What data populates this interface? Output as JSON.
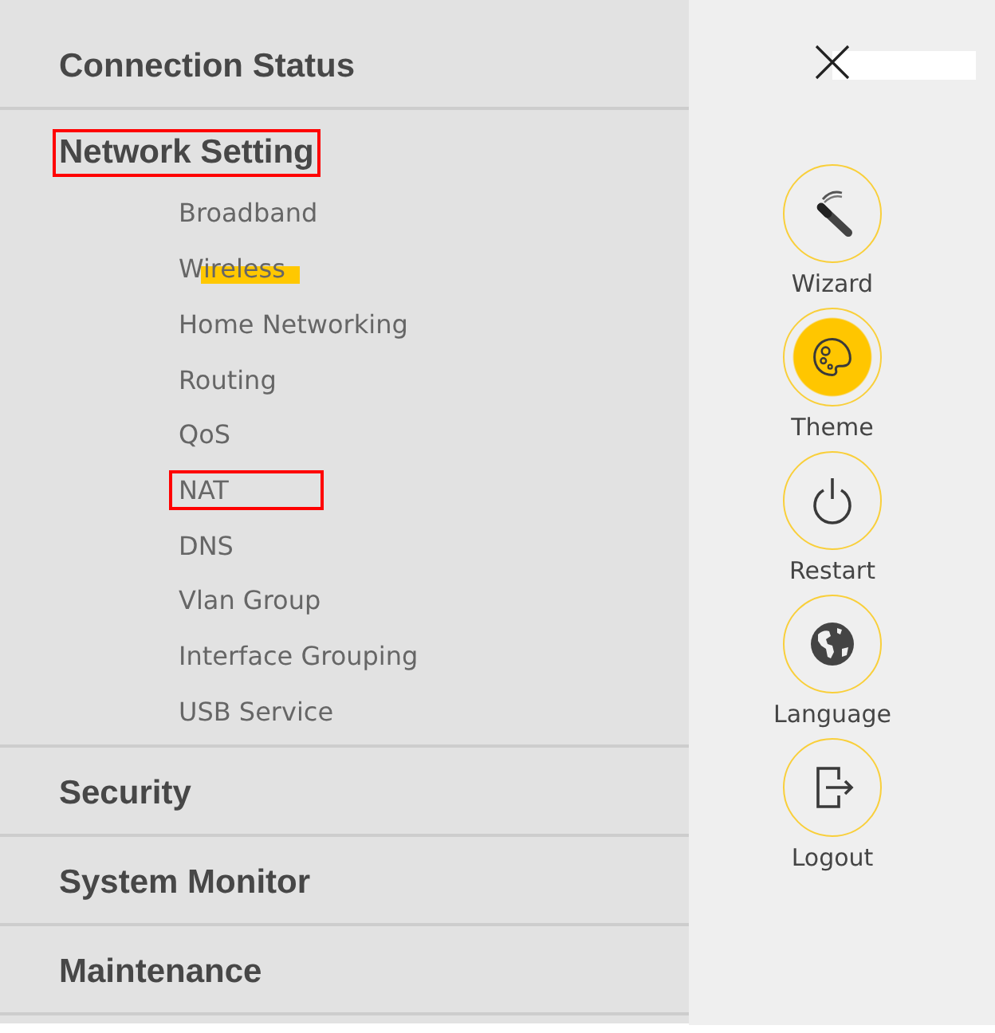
{
  "menu": [
    {
      "label": "Connection Status",
      "boxed": false
    },
    {
      "label": "Network Setting",
      "boxed": true,
      "children": [
        {
          "label": "Broadband",
          "boxed": false,
          "underlined": false
        },
        {
          "label": "Wireless",
          "boxed": false,
          "underlined": true
        },
        {
          "label": "Home Networking",
          "boxed": false,
          "underlined": false
        },
        {
          "label": "Routing",
          "boxed": false,
          "underlined": false
        },
        {
          "label": "QoS",
          "boxed": false,
          "underlined": false
        },
        {
          "label": "NAT",
          "boxed": true,
          "underlined": false
        },
        {
          "label": "DNS",
          "boxed": false,
          "underlined": false
        },
        {
          "label": "Vlan Group",
          "boxed": false,
          "underlined": false
        },
        {
          "label": "Interface Grouping",
          "boxed": false,
          "underlined": false
        },
        {
          "label": "USB Service",
          "boxed": false,
          "underlined": false
        }
      ]
    },
    {
      "label": "Security",
      "boxed": false
    },
    {
      "label": "System Monitor",
      "boxed": false
    },
    {
      "label": "Maintenance",
      "boxed": false
    }
  ],
  "actions": [
    {
      "kind": "wizard",
      "label": "Wizard",
      "selected": false
    },
    {
      "kind": "theme",
      "label": "Theme",
      "selected": true
    },
    {
      "kind": "restart",
      "label": "Restart",
      "selected": false
    },
    {
      "kind": "language",
      "label": "Language",
      "selected": false
    },
    {
      "kind": "logout",
      "label": "Logout",
      "selected": false
    }
  ]
}
